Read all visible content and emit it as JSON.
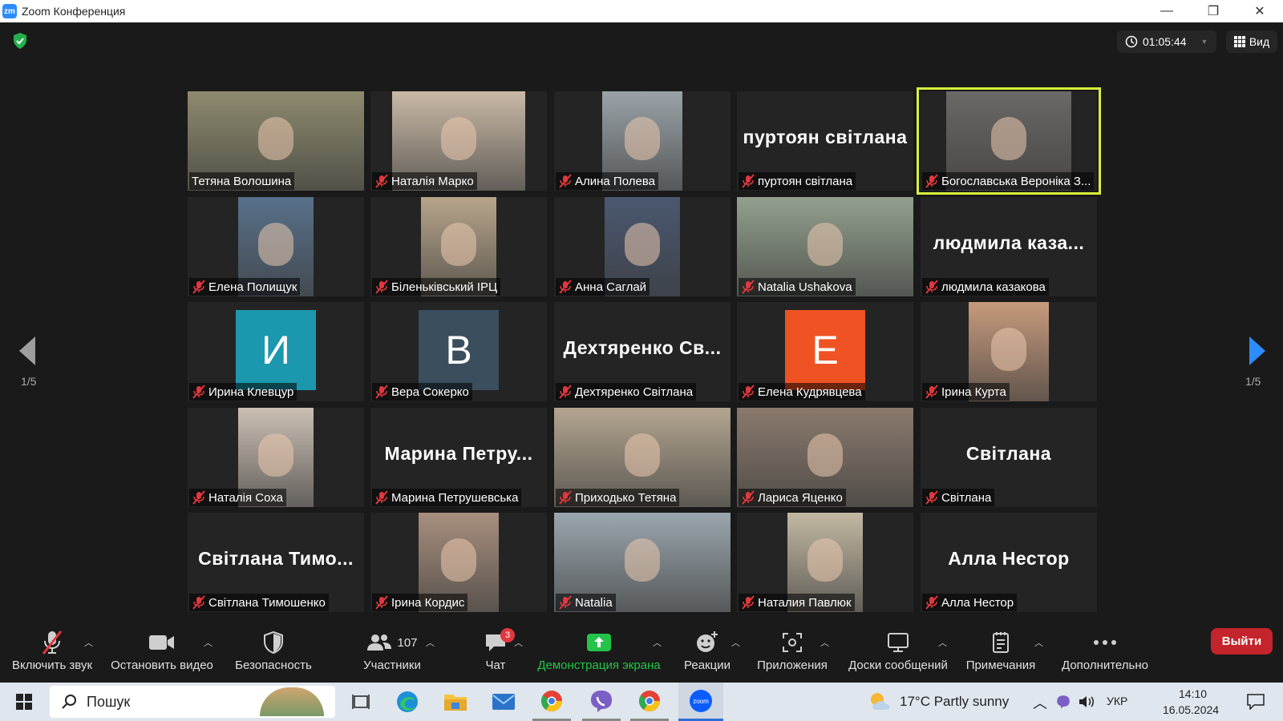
{
  "window": {
    "logo": "zm",
    "title": "Zoom Конференция"
  },
  "header": {
    "timer": "01:05:44",
    "view_label": "Вид"
  },
  "paging": {
    "left": "1/5",
    "right": "1/5"
  },
  "participants": [
    {
      "name": "Тетяна Волошина",
      "muted": false,
      "kind": "video",
      "color": "#8e8a6e"
    },
    {
      "name": "Наталія Марко",
      "muted": true,
      "kind": "video",
      "color": "#c9b9a6"
    },
    {
      "name": "Алина Полева",
      "muted": true,
      "kind": "video",
      "color": "#9aa3a8"
    },
    {
      "name": "пуртоян світлана",
      "muted": true,
      "kind": "name",
      "display": "пуртоян світлана"
    },
    {
      "name": "Богославська Вероніка З...",
      "muted": true,
      "kind": "video",
      "color": "#6b6866",
      "active": true
    },
    {
      "name": "Елена Полищук",
      "muted": true,
      "kind": "video",
      "color": "#58718a"
    },
    {
      "name": "Біленьківський ІРЦ",
      "muted": true,
      "kind": "video",
      "color": "#b7a58b"
    },
    {
      "name": "Анна Саглай",
      "muted": true,
      "kind": "video",
      "color": "#4a5870"
    },
    {
      "name": "Natalia Ushakova",
      "muted": true,
      "kind": "video",
      "color": "#93a08e"
    },
    {
      "name": "людмила казакова",
      "muted": true,
      "kind": "name",
      "display": "людмила  каза..."
    },
    {
      "name": "Ирина Клевцур",
      "muted": true,
      "kind": "avatar",
      "letter": "И",
      "color": "#1b98ad"
    },
    {
      "name": "Вера Сокерко",
      "muted": true,
      "kind": "avatar",
      "letter": "B",
      "color": "#3a4e5e"
    },
    {
      "name": "Дехтяренко Світлана",
      "muted": true,
      "kind": "name",
      "display": "Дехтяренко  Св..."
    },
    {
      "name": "Елена Кудрявцева",
      "muted": true,
      "kind": "avatar",
      "letter": "E",
      "color": "#ef5323"
    },
    {
      "name": "Ірина Курта",
      "muted": true,
      "kind": "video",
      "color": "#c79a7c"
    },
    {
      "name": "Наталія Соха",
      "muted": true,
      "kind": "video",
      "color": "#cbbfb3"
    },
    {
      "name": "Марина Петрушевська",
      "muted": true,
      "kind": "name",
      "display": "Марина  Петру..."
    },
    {
      "name": "Приходько Тетяна",
      "muted": true,
      "kind": "video",
      "color": "#b3a590"
    },
    {
      "name": "Лариса Яценко",
      "muted": true,
      "kind": "video",
      "color": "#8a7a6d"
    },
    {
      "name": "Світлана",
      "muted": true,
      "kind": "name",
      "display": "Світлана"
    },
    {
      "name": "Світлана Тимошенко",
      "muted": true,
      "kind": "name",
      "display": "Світлана  Тимо..."
    },
    {
      "name": "Ірина Кордис",
      "muted": true,
      "kind": "video",
      "color": "#a88f7e"
    },
    {
      "name": "Natalia",
      "muted": true,
      "kind": "video",
      "color": "#9aa6ad"
    },
    {
      "name": "Наталия Павлюк",
      "muted": true,
      "kind": "video",
      "color": "#c2b8a2"
    },
    {
      "name": "Алла Нестор",
      "muted": true,
      "kind": "name",
      "display": "Алла Нестор"
    }
  ],
  "toolbar": {
    "unmute": "Включить звук",
    "stop_video": "Остановить видео",
    "security": "Безопасность",
    "participants": "Участники",
    "participants_count": "107",
    "chat": "Чат",
    "chat_badge": "3",
    "share": "Демонстрация экрана",
    "reactions": "Реакции",
    "apps": "Приложения",
    "whiteboards": "Доски сообщений",
    "notes": "Примечания",
    "more": "Дополнительно",
    "leave": "Выйти"
  },
  "colors": {
    "share_green": "#24c349",
    "leave_red": "#c4242b",
    "active_border": "#d7f23a",
    "mute_red": "#e0383e"
  },
  "taskbar": {
    "search_placeholder": "Пошук",
    "weather": "17°C  Partly sunny",
    "language": "УКР",
    "time": "14:10",
    "date": "16.05.2024"
  }
}
